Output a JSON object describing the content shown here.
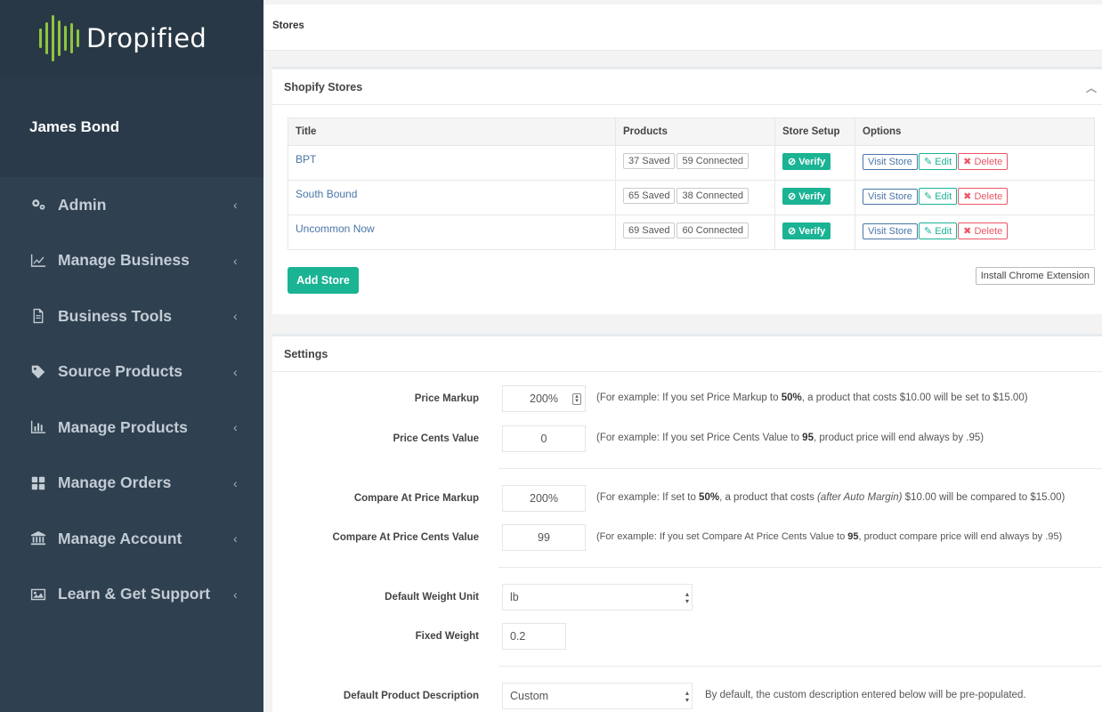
{
  "sidebar": {
    "logo_text": "Dropified",
    "user_name": "James Bond",
    "items": [
      {
        "label": "Admin",
        "icon": "gears-icon"
      },
      {
        "label": "Manage Business",
        "icon": "line-chart-icon"
      },
      {
        "label": "Business Tools",
        "icon": "file-icon"
      },
      {
        "label": "Source Products",
        "icon": "tag-icon"
      },
      {
        "label": "Manage Products",
        "icon": "bar-chart-icon"
      },
      {
        "label": "Manage Orders",
        "icon": "grid-icon"
      },
      {
        "label": "Manage Account",
        "icon": "bank-icon"
      },
      {
        "label": "Learn & Get Support",
        "icon": "image-icon"
      }
    ],
    "chevron": "‹"
  },
  "header": {
    "title": "Stores"
  },
  "stores_panel": {
    "title": "Shopify Stores",
    "columns": [
      "Title",
      "Products",
      "Store Setup",
      "Options"
    ],
    "rows": [
      {
        "title": "BPT",
        "saved": "37 Saved",
        "connected": "59 Connected"
      },
      {
        "title": "South Bound",
        "saved": "65 Saved",
        "connected": "38 Connected"
      },
      {
        "title": "Uncommon Now",
        "saved": "69 Saved",
        "connected": "60 Connected"
      }
    ],
    "verify_label": "⊘ Verify",
    "visit_label": "Visit Store",
    "edit_label": "✎ Edit",
    "delete_label": "✖ Delete",
    "add_store_label": "Add Store",
    "chrome_ext_label": "Install Chrome Extension"
  },
  "settings_panel": {
    "title": "Settings",
    "price_markup": {
      "label": "Price Markup",
      "value": "200%",
      "help_pre": "(For example: If you set Price Markup to ",
      "help_bold": "50%",
      "help_post": ", a product that costs $10.00 will be set to $15.00)"
    },
    "price_cents": {
      "label": "Price Cents Value",
      "value": "0",
      "help_pre": "(For example: If you set Price Cents Value to ",
      "help_bold": "95",
      "help_post": ", product price will end always by .95)"
    },
    "compare_markup": {
      "label": "Compare At Price Markup",
      "value": "200%",
      "help_pre": "(For example: If set to ",
      "help_bold": "50%",
      "help_mid": ", a product that costs ",
      "help_ital": "(after Auto Margin)",
      "help_post": " $10.00 will be compared to $15.00)"
    },
    "compare_cents": {
      "label": "Compare At Price Cents Value",
      "value": "99",
      "help_pre": "(For example: If you set Compare At Price Cents Value to ",
      "help_bold": "95",
      "help_post": ", product compare price will end always by .95)"
    },
    "weight_unit": {
      "label": "Default Weight Unit",
      "value": "lb"
    },
    "fixed_weight": {
      "label": "Fixed Weight",
      "value": "0.2"
    },
    "product_description": {
      "label": "Default Product Description",
      "value": "Custom",
      "help": "By default, the custom description entered below will be pre-populated."
    }
  },
  "colors": {
    "sidebar_bg": "#2f4050",
    "accent": "#1ab394",
    "logo_green": "#8dc63f",
    "danger": "#ed5565",
    "link": "#4a76a8"
  }
}
